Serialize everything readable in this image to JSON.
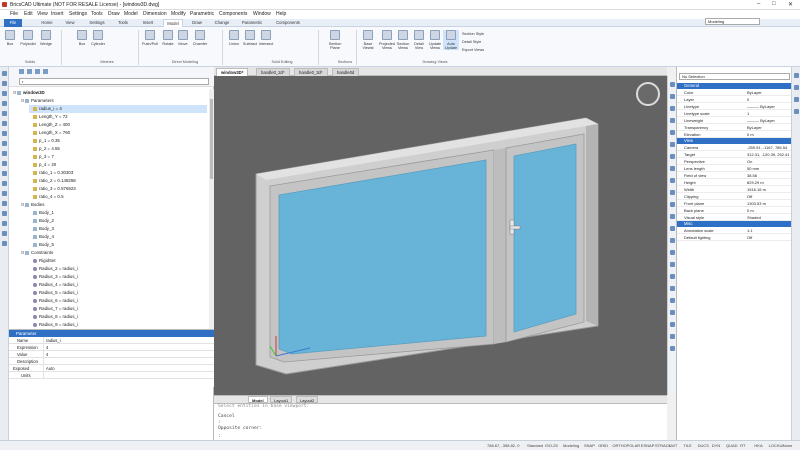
{
  "window": {
    "title": "BricsCAD Ultimate (NOT FOR RESALE License) - [window3D.dwg]",
    "controls": [
      "–",
      "□",
      "✕"
    ]
  },
  "menu": [
    "File",
    "Edit",
    "View",
    "Insert",
    "Settings",
    "Tools",
    "Draw",
    "Model",
    "Dimension",
    "Modify",
    "Parametric",
    "Components",
    "Window",
    "Help"
  ],
  "ribbon_tabs": [
    "File",
    "Home",
    "View",
    "Settings",
    "Tools",
    "Insert",
    "Model",
    "Draw",
    "Change",
    "Parametric",
    "Components"
  ],
  "workspace": "Modeling",
  "ribbon": {
    "buttons": [
      "Box",
      "Polysolid",
      "Wedge",
      "Box",
      "Cylinder",
      "Push/Pull",
      "Rotate",
      "Move",
      "Chamfer",
      "Union",
      "Subtract",
      "Intersect",
      "Section Plane",
      "Base Viewst",
      "Projected Views",
      "Section Views",
      "Detail View",
      "Update Views",
      "Auto Update"
    ],
    "small": [
      "Section Style",
      "Detail Style",
      "Export Views"
    ],
    "groups": [
      "Solids",
      "Meshes",
      "Direct Modeling",
      "Solid Editing",
      "Sections",
      "Drawing Views"
    ]
  },
  "structure": {
    "search": "r",
    "tree": [
      {
        "text": "window3D",
        "level": 0,
        "icon": "b",
        "bold": true
      },
      {
        "text": "Parameters",
        "level": 1,
        "icon": "b"
      },
      {
        "text": "radius_i = 4",
        "level": 2,
        "icon": "y",
        "selected": true
      },
      {
        "text": "Length_Y = 72",
        "level": 2,
        "icon": "y"
      },
      {
        "text": "Length_Z = 400",
        "level": 2,
        "icon": "y"
      },
      {
        "text": "Length_X = 760",
        "level": 2,
        "icon": "y"
      },
      {
        "text": "p_1 = 0.35",
        "level": 2,
        "icon": "y"
      },
      {
        "text": "p_2 = 4.55",
        "level": 2,
        "icon": "y"
      },
      {
        "text": "p_3 = 7",
        "level": 2,
        "icon": "y"
      },
      {
        "text": "p_4 = 20",
        "level": 2,
        "icon": "y"
      },
      {
        "text": "ratio_1 = 0.30303",
        "level": 2,
        "icon": "y"
      },
      {
        "text": "ratio_2 = 0.148258",
        "level": 2,
        "icon": "y"
      },
      {
        "text": "ratio_3 = 0.576923",
        "level": 2,
        "icon": "y"
      },
      {
        "text": "ratio_4 = 0.5",
        "level": 2,
        "icon": "y"
      },
      {
        "text": "Bodies",
        "level": 1,
        "icon": "b"
      },
      {
        "text": "Body_1",
        "level": 2,
        "icon": "b"
      },
      {
        "text": "Body_2",
        "level": 2,
        "icon": "b"
      },
      {
        "text": "Body_3",
        "level": 2,
        "icon": "b"
      },
      {
        "text": "Body_4",
        "level": 2,
        "icon": "b"
      },
      {
        "text": "Body_5",
        "level": 2,
        "icon": "b"
      },
      {
        "text": "Constraints",
        "level": 1,
        "icon": "b"
      },
      {
        "text": "RigidSet",
        "level": 2,
        "icon": "c"
      },
      {
        "text": "Radius_2 = radius_i",
        "level": 2,
        "icon": "c"
      },
      {
        "text": "Radius_3 = radius_i",
        "level": 2,
        "icon": "c"
      },
      {
        "text": "Radius_4 = radius_i",
        "level": 2,
        "icon": "c"
      },
      {
        "text": "Radius_5 = radius_i",
        "level": 2,
        "icon": "c"
      },
      {
        "text": "Radius_6 = radius_i",
        "level": 2,
        "icon": "c"
      },
      {
        "text": "Radius_7 = radius_i",
        "level": 2,
        "icon": "c"
      },
      {
        "text": "Radius_8 = radius_i",
        "level": 2,
        "icon": "c"
      },
      {
        "text": "Radius_9 = radius_i",
        "level": 2,
        "icon": "c"
      },
      {
        "text": "RigidSet_11",
        "level": 2,
        "icon": "c"
      },
      {
        "text": "Radius_12 = 6.48 m",
        "level": 2,
        "icon": "c"
      }
    ],
    "param_header": "Parameter",
    "params": [
      {
        "k": "Name",
        "v": "radius_i"
      },
      {
        "k": "Expression",
        "v": "4"
      },
      {
        "k": "Value",
        "v": "4"
      },
      {
        "k": "Description",
        "v": ""
      },
      {
        "k": "Exposed",
        "v": "Auto"
      },
      {
        "k": "Units",
        "v": ""
      }
    ]
  },
  "drawing_tabs": [
    "window3D*",
    "handle0_2d*",
    "handle0_3d*",
    "handle0d"
  ],
  "layout_tabs": [
    "Model",
    "Layout1",
    "Layout2"
  ],
  "command_lines": [
    "Select entities in base viewport:",
    "",
    "Cancel",
    ":",
    "Opposite corner:",
    ":"
  ],
  "properties": {
    "selection": "No Selection",
    "sections": [
      {
        "name": "General",
        "rows": [
          {
            "k": "Color",
            "v": "ByLayer"
          },
          {
            "k": "Layer",
            "v": "0"
          },
          {
            "k": "Linetype",
            "v": "——— ByLayer"
          },
          {
            "k": "Linetype scale",
            "v": "1"
          },
          {
            "k": "Lineweight",
            "v": "——— ByLayer"
          },
          {
            "k": "Transparency",
            "v": "ByLayer"
          },
          {
            "k": "Elevation",
            "v": "0 m"
          }
        ]
      },
      {
        "name": "View",
        "rows": [
          {
            "k": "Camera",
            "v": "-259.91, -1167, 785.54"
          },
          {
            "k": "Target",
            "v": "312.31, -120.39, 252.41"
          },
          {
            "k": "Perspective",
            "v": "On"
          },
          {
            "k": "Lens length",
            "v": "50 mm"
          },
          {
            "k": "Field of view",
            "v": "38.58"
          },
          {
            "k": "Height",
            "v": "829.29 m"
          },
          {
            "k": "Width",
            "v": "1516.16 m"
          },
          {
            "k": "Clipping",
            "v": "Off"
          },
          {
            "k": "Front plane",
            "v": "1303.53 m"
          },
          {
            "k": "Back plane",
            "v": "0 m"
          },
          {
            "k": "Visual style",
            "v": "Shaded"
          }
        ]
      },
      {
        "name": "Misc",
        "rows": [
          {
            "k": "Annotation scale",
            "v": "1:1"
          },
          {
            "k": "Default lighting",
            "v": "Off"
          }
        ]
      }
    ]
  },
  "status": {
    "coords": "788.67, -358.82, 0",
    "standard": "Standard",
    "iso": "ISO-25",
    "mode": "Modeling",
    "toggles": [
      "SNAP",
      "GRID",
      "ORTHO",
      "POLAR",
      "ESNAP",
      "STRACK",
      "LWT",
      "TILE",
      "DUCS",
      "DYN",
      "QUAD",
      "RT",
      "HKA",
      "LOCKUI",
      "None"
    ]
  },
  "colors": {
    "accent": "#2f6fc4",
    "viewport": "#636363",
    "glass": "#68b4d8",
    "frame": "#d2d2d2"
  }
}
